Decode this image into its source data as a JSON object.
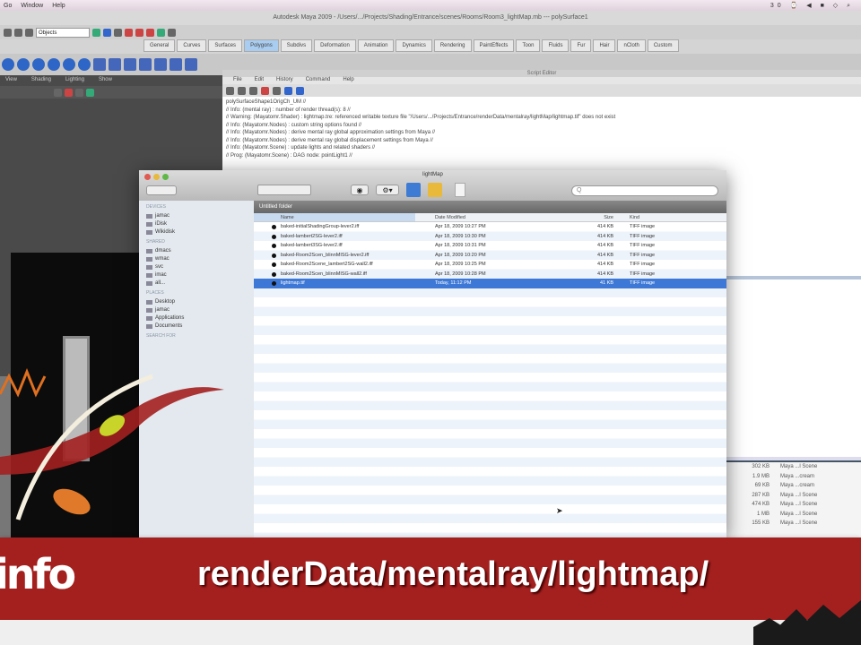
{
  "menubar": {
    "items": [
      "Go",
      "Window",
      "Help"
    ],
    "status": "30  ⌚ ◀ ■ ◇ ⌕"
  },
  "maya": {
    "title": "Autodesk Maya 2009 - /Users/.../Projects/Shading/Entrance/scenes/Rooms/Room3_lightMap.mb --- polySurface1",
    "objects_field": "Objects",
    "shelf_tabs": [
      "General",
      "Curves",
      "Surfaces",
      "Polygons",
      "Subdivs",
      "Deformation",
      "Animation",
      "Dynamics",
      "Rendering",
      "PaintEffects",
      "Toon",
      "Fluids",
      "Fur",
      "Hair",
      "nCloth",
      "Custom"
    ],
    "active_tab": "Polygons",
    "left_menu": [
      "View",
      "Shading",
      "Lighting",
      "Show"
    ]
  },
  "script_editor": {
    "title": "Script Editor",
    "menu": [
      "File",
      "Edit",
      "History",
      "Command",
      "Help"
    ],
    "lines": [
      "polySurfaceShape1OrigCh_UM //",
      "// Info: (mental ray) : number of render thread(s): 8 //",
      "// Warning: (Mayatomr.Shader) : lightmap.tre: referenced writable texture file \"/Users/.../Projects/Entrance/renderData/mentalray/lightMap/lightmap.tif\" does not exist",
      "// Info: (Mayatomr.Nodes) : custom string options found //",
      "// Info: (Mayatomr.Nodes) : derive mental ray global approximation settings from Maya //",
      "// Info: (Mayatomr.Nodes) : derive mental ray global displacement settings from Maya //",
      "// Info: (Mayatomr.Scene) : update lights and related shaders //",
      "// Prog: (Mayatomr.Scene) : DAG node: pointLight1 //"
    ]
  },
  "finder": {
    "title": "lightMap",
    "search_placeholder": "Q",
    "sidebar": [
      {
        "header": "Devices",
        "items": [
          "jamac",
          "iDisk",
          "Wikidisk"
        ]
      },
      {
        "header": "Shared",
        "items": [
          "dmacs",
          "wmac",
          "svc",
          "imac",
          "all..."
        ]
      },
      {
        "header": "Places",
        "items": [
          "Desktop",
          "jamac",
          "Applications",
          "Documents"
        ]
      },
      {
        "header": "Search For",
        "items": []
      }
    ],
    "path_bar": "Untitled folder",
    "columns": [
      "Name",
      "Date Modified",
      "Size",
      "Kind"
    ],
    "files": [
      {
        "name": "baked-initialShadingGroup-lever2.iff",
        "date": "Apr 18, 2009 10:27 PM",
        "size": "414 KB",
        "kind": "TIFF image"
      },
      {
        "name": "baked-lambert2SG-lever2.iff",
        "date": "Apr 18, 2009 10:30 PM",
        "size": "414 KB",
        "kind": "TIFF image"
      },
      {
        "name": "baked-lambert3SG-lever2.iff",
        "date": "Apr 18, 2009 10:31 PM",
        "size": "414 KB",
        "kind": "TIFF image"
      },
      {
        "name": "baked-Room2Scen_blinnMISG-lever2.iff",
        "date": "Apr 18, 2009 10:20 PM",
        "size": "414 KB",
        "kind": "TIFF image"
      },
      {
        "name": "baked-Room2Scene_lambert2SG-wall2.iff",
        "date": "Apr 18, 2009 10:25 PM",
        "size": "414 KB",
        "kind": "TIFF image"
      },
      {
        "name": "baked-Room2Scen_blinnMISG-wall2.iff",
        "date": "Apr 18, 2009 10:28 PM",
        "size": "414 KB",
        "kind": "TIFF image"
      },
      {
        "name": "lightmap.tif",
        "date": "Today, 11:12 PM",
        "size": "41 KB",
        "kind": "TIFF image"
      }
    ],
    "selected_index": 6
  },
  "right_list": [
    {
      "size": "302 KB",
      "kind": "Maya ...l Scene"
    },
    {
      "size": "1.9 MB",
      "kind": "Maya ...cream"
    },
    {
      "size": "69 KB",
      "kind": "Maya ...cream"
    },
    {
      "size": "287 KB",
      "kind": "Maya ...l Scene"
    },
    {
      "size": "474 KB",
      "kind": "Maya ...l Scene"
    },
    {
      "size": "1 MB",
      "kind": "Maya ...l Scene"
    },
    {
      "size": "155 KB",
      "kind": "Maya ...l Scene"
    }
  ],
  "banner": {
    "logo": "info",
    "text": "renderData/mentalray/lightmap/",
    "color": "#a3201f"
  }
}
